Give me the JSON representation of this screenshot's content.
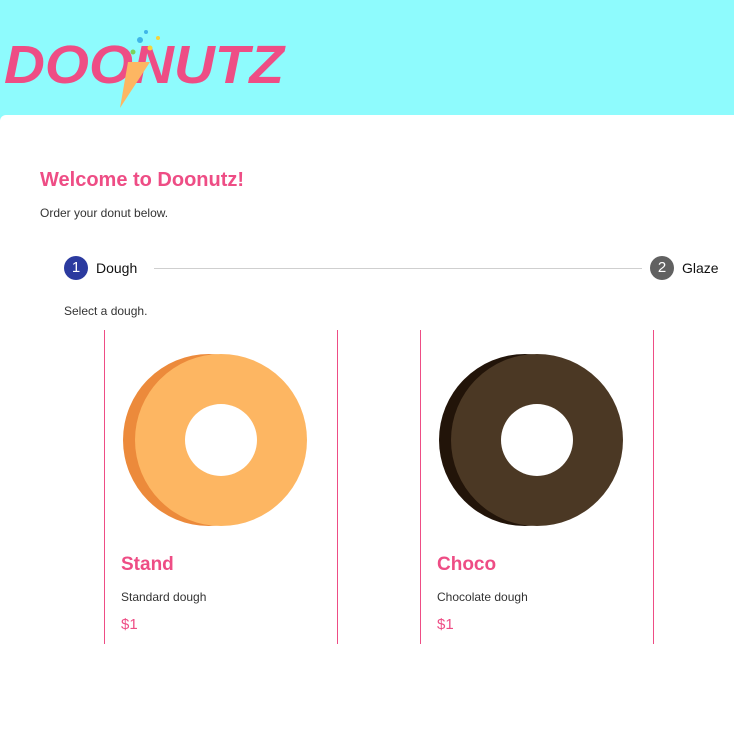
{
  "brand": {
    "logo_text": "DOONUTZ",
    "colors": {
      "header_bg": "#8efbfd",
      "accent": "#ee4d85",
      "active_step": "#2b3a9f",
      "inactive_step": "#616161"
    }
  },
  "welcome": {
    "title": "Welcome to Doonutz!",
    "subtitle": "Order your donut below."
  },
  "stepper": {
    "steps": [
      {
        "number": "1",
        "label": "Dough",
        "state": "active"
      },
      {
        "number": "2",
        "label": "Glaze",
        "state": "inactive"
      }
    ]
  },
  "dough": {
    "hint": "Select a dough.",
    "options": [
      {
        "name": "Stand",
        "description": "Standard dough",
        "price": "$1",
        "color": "#fdb662",
        "shade": "#ec8a3b"
      },
      {
        "name": "Choco",
        "description": "Chocolate dough",
        "price": "$1",
        "color": "#4b3824",
        "shade": "#221409"
      }
    ]
  }
}
